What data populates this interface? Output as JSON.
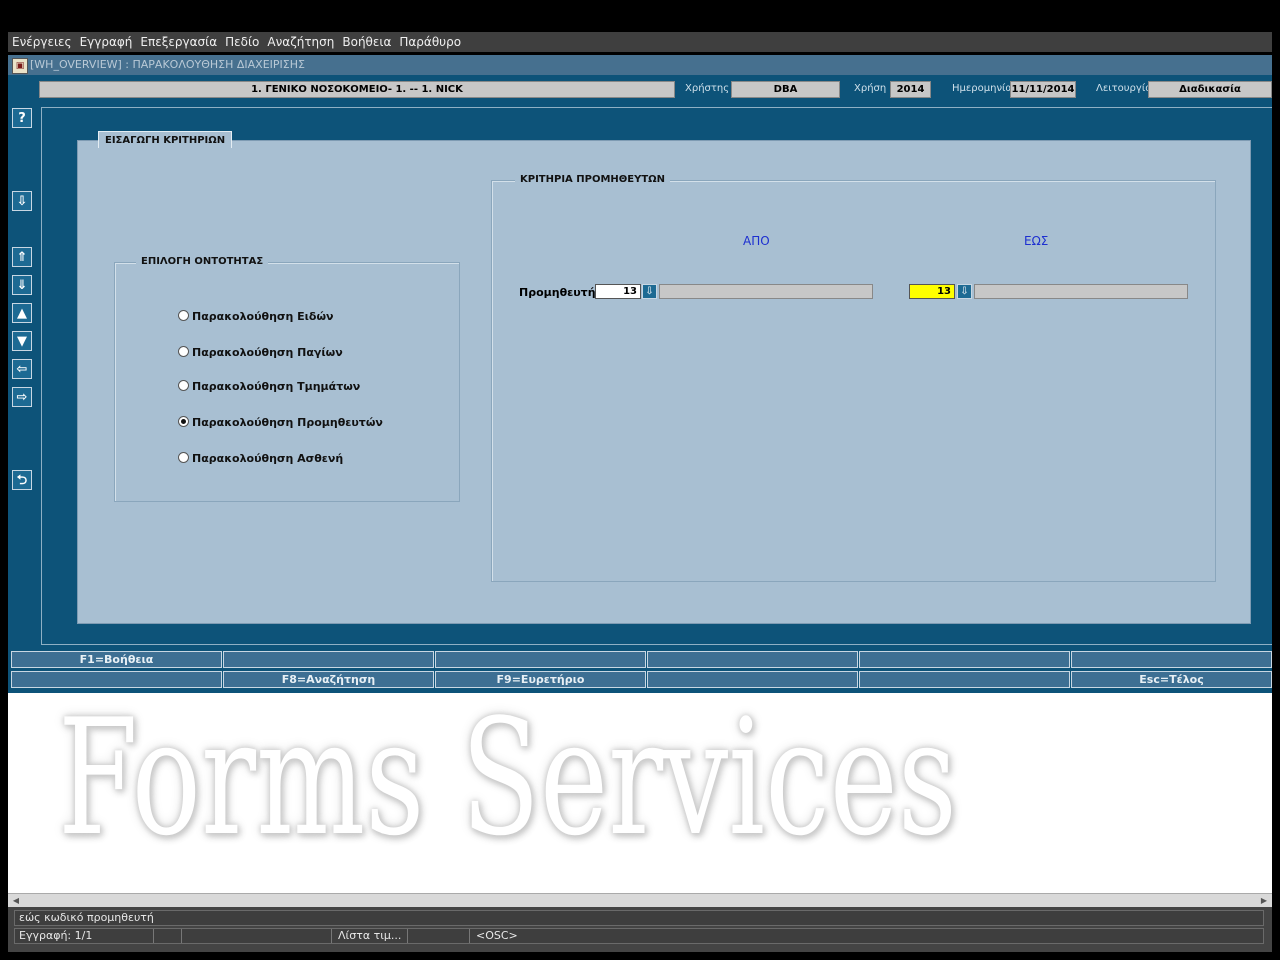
{
  "menu": [
    "Ενέργειες",
    "Εγγραφή",
    "Επεξεργασία",
    "Πεδίο",
    "Αναζήτηση",
    "Βοήθεια",
    "Παράθυρο"
  ],
  "window": {
    "title": "[WH_OVERVIEW]  :  ΠΑΡΑΚΟΛΟΥΘΗΣΗ ΔΙΑΧΕΙΡΙΣΗΣ"
  },
  "infobar": {
    "organization": "1. ΓΕΝΙΚΟ ΝΟΣΟΚΟΜΕΙΟ- 1. -- 1. NICK",
    "user_label": "Χρήστης",
    "user_value": "DBA",
    "year_label": "Χρήση",
    "year_value": "2014",
    "date_label": "Ημερομηνία",
    "date_value": "11/11/2014",
    "function_label": "Λειτουργία",
    "function_value": "Διαδικασία"
  },
  "toolbar": {
    "help": "?",
    "download": "⇩",
    "first": "⇑",
    "last": "⇓",
    "up": "▲",
    "down": "▼",
    "prev": "⇦",
    "next": "⇨",
    "back": "⮌"
  },
  "panel": {
    "title": "ΕΙΣΑΓΩΓΗ ΚΡΙΤΗΡΙΩΝ"
  },
  "entity": {
    "title": "ΕΠΙΛΟΓΗ ΟΝΤΟΤΗΤΑΣ",
    "options": [
      {
        "label": "Παρακολούθηση Ειδών",
        "selected": false
      },
      {
        "label": "Παρακολούθηση Παγίων",
        "selected": false
      },
      {
        "label": "Παρακολούθηση Τμημάτων",
        "selected": false
      },
      {
        "label": "Παρακολούθηση Προμηθευτών",
        "selected": true
      },
      {
        "label": "Παρακολούθηση Ασθενή",
        "selected": false
      }
    ]
  },
  "criteria": {
    "title": "ΚΡΙΤΗΡΙΑ ΠΡΟΜΗΘΕΥΤΩΝ",
    "from_header": "ΑΠΟ",
    "to_header": "ΕΩΣ",
    "supplier_label": "Προμηθευτής",
    "from_value": "13",
    "to_value": "13",
    "from_desc": "",
    "to_desc": "",
    "lov_icon": "⇩"
  },
  "fkeys": {
    "row1": [
      "F1=Βοήθεια",
      "",
      "",
      "",
      "",
      ""
    ],
    "row2": [
      "",
      "F8=Αναζήτηση",
      "F9=Ευρετήριο",
      "",
      "",
      "Esc=Τέλος"
    ]
  },
  "background_brand": "Forms Services",
  "status": {
    "message": "εώς κωδικό προμηθευτή",
    "record": "Εγγραφή: 1/1",
    "lov": "Λίστα τιμ...",
    "mode": "<OSC>"
  },
  "colors": {
    "canvas_bg": "#0d5379",
    "panel_bg": "#a8bfd2",
    "highlight_field": "#ffff00",
    "header_text": "#1d2fd0"
  }
}
